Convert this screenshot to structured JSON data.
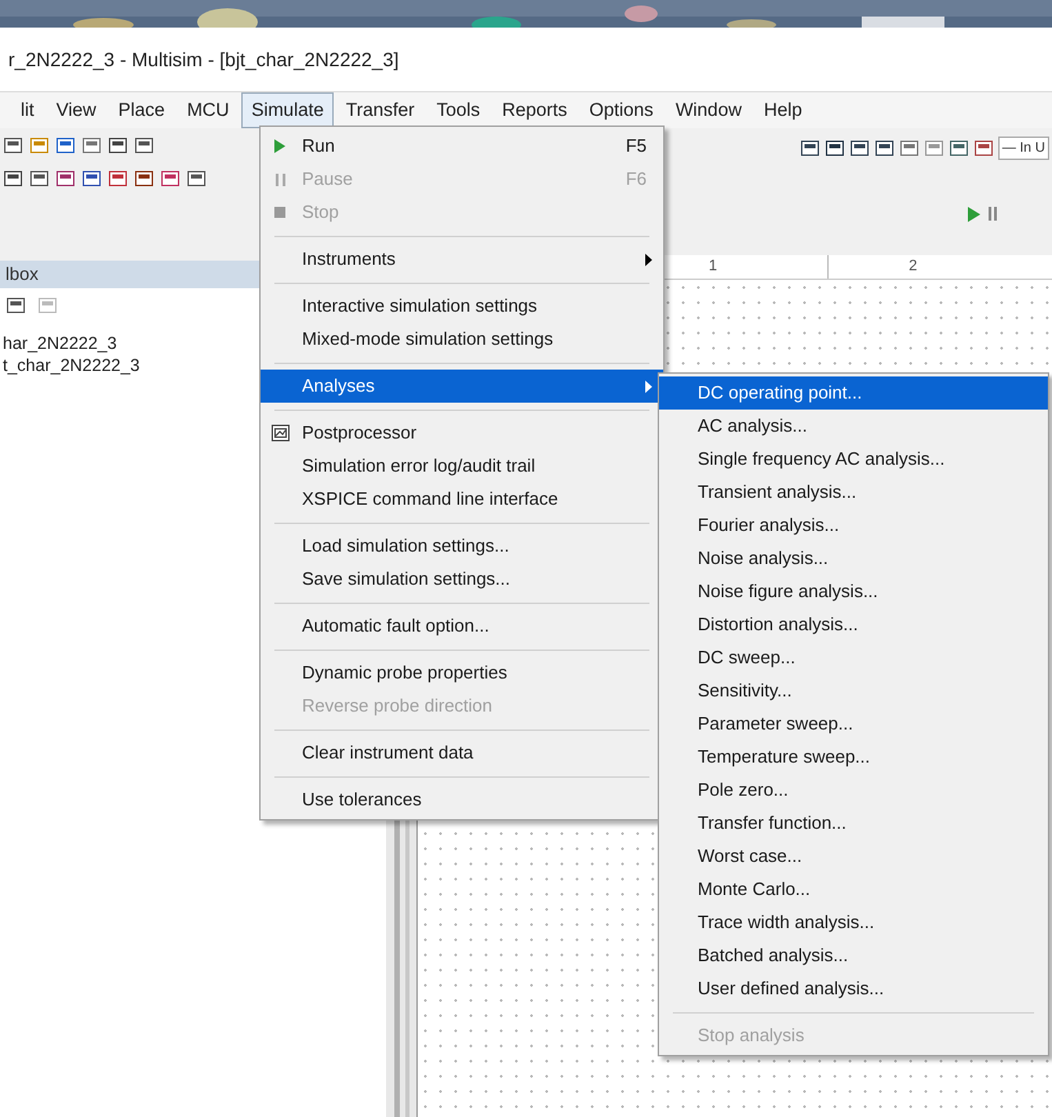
{
  "title": "r_2N2222_3 - Multisim - [bjt_char_2N2222_3]",
  "menubar": [
    {
      "label": "lit",
      "selected": false
    },
    {
      "label": "View",
      "selected": false
    },
    {
      "label": "Place",
      "selected": false
    },
    {
      "label": "MCU",
      "selected": false
    },
    {
      "label": "Simulate",
      "selected": true
    },
    {
      "label": "Transfer",
      "selected": false
    },
    {
      "label": "Tools",
      "selected": false
    },
    {
      "label": "Reports",
      "selected": false
    },
    {
      "label": "Options",
      "selected": false
    },
    {
      "label": "Window",
      "selected": false
    },
    {
      "label": "Help",
      "selected": false
    }
  ],
  "toolbar_combo": "— In U",
  "ruler": [
    "1",
    "2"
  ],
  "toolbox": {
    "title": "lbox",
    "items": [
      "har_2N2222_3",
      "t_char_2N2222_3"
    ]
  },
  "simulate_menu": [
    {
      "kind": "item",
      "label": "Run",
      "shortcut": "F5",
      "disabled": false,
      "selected": false
    },
    {
      "kind": "item",
      "label": "Pause",
      "shortcut": "F6",
      "disabled": true,
      "selected": false
    },
    {
      "kind": "item",
      "label": "Stop",
      "disabled": true,
      "selected": false
    },
    {
      "kind": "separator"
    },
    {
      "kind": "submenu",
      "label": "Instruments",
      "disabled": false,
      "selected": false
    },
    {
      "kind": "separator"
    },
    {
      "kind": "item",
      "label": "Interactive simulation settings",
      "disabled": false,
      "selected": false
    },
    {
      "kind": "item",
      "label": "Mixed-mode simulation settings",
      "disabled": false,
      "selected": false
    },
    {
      "kind": "separator"
    },
    {
      "kind": "submenu",
      "label": "Analyses",
      "disabled": false,
      "selected": true
    },
    {
      "kind": "separator"
    },
    {
      "kind": "item",
      "label": "Postprocessor",
      "disabled": false,
      "selected": false
    },
    {
      "kind": "item",
      "label": "Simulation error log/audit trail",
      "disabled": false,
      "selected": false
    },
    {
      "kind": "item",
      "label": "XSPICE command line interface",
      "disabled": false,
      "selected": false
    },
    {
      "kind": "separator"
    },
    {
      "kind": "item",
      "label": "Load simulation settings...",
      "disabled": false,
      "selected": false
    },
    {
      "kind": "item",
      "label": "Save simulation settings...",
      "disabled": false,
      "selected": false
    },
    {
      "kind": "separator"
    },
    {
      "kind": "item",
      "label": "Automatic fault option...",
      "disabled": false,
      "selected": false
    },
    {
      "kind": "separator"
    },
    {
      "kind": "item",
      "label": "Dynamic probe properties",
      "disabled": false,
      "selected": false
    },
    {
      "kind": "item",
      "label": "Reverse probe direction",
      "disabled": true,
      "selected": false
    },
    {
      "kind": "separator"
    },
    {
      "kind": "item",
      "label": "Clear instrument data",
      "disabled": false,
      "selected": false
    },
    {
      "kind": "separator"
    },
    {
      "kind": "item",
      "label": "Use tolerances",
      "disabled": false,
      "selected": false
    }
  ],
  "analyses_menu": [
    {
      "kind": "item",
      "label": "DC operating point...",
      "disabled": false,
      "selected": true
    },
    {
      "kind": "item",
      "label": "AC analysis...",
      "disabled": false,
      "selected": false
    },
    {
      "kind": "item",
      "label": "Single frequency AC analysis...",
      "disabled": false,
      "selected": false
    },
    {
      "kind": "item",
      "label": "Transient analysis...",
      "disabled": false,
      "selected": false
    },
    {
      "kind": "item",
      "label": "Fourier analysis...",
      "disabled": false,
      "selected": false
    },
    {
      "kind": "item",
      "label": "Noise analysis...",
      "disabled": false,
      "selected": false
    },
    {
      "kind": "item",
      "label": "Noise figure analysis...",
      "disabled": false,
      "selected": false
    },
    {
      "kind": "item",
      "label": "Distortion analysis...",
      "disabled": false,
      "selected": false
    },
    {
      "kind": "item",
      "label": "DC sweep...",
      "disabled": false,
      "selected": false
    },
    {
      "kind": "item",
      "label": "Sensitivity...",
      "disabled": false,
      "selected": false
    },
    {
      "kind": "item",
      "label": "Parameter sweep...",
      "disabled": false,
      "selected": false
    },
    {
      "kind": "item",
      "label": "Temperature sweep...",
      "disabled": false,
      "selected": false
    },
    {
      "kind": "item",
      "label": "Pole zero...",
      "disabled": false,
      "selected": false
    },
    {
      "kind": "item",
      "label": "Transfer function...",
      "disabled": false,
      "selected": false
    },
    {
      "kind": "item",
      "label": "Worst case...",
      "disabled": false,
      "selected": false
    },
    {
      "kind": "item",
      "label": "Monte Carlo...",
      "disabled": false,
      "selected": false
    },
    {
      "kind": "item",
      "label": "Trace width analysis...",
      "disabled": false,
      "selected": false
    },
    {
      "kind": "item",
      "label": "Batched analysis...",
      "disabled": false,
      "selected": false
    },
    {
      "kind": "item",
      "label": "User defined analysis...",
      "disabled": false,
      "selected": false
    },
    {
      "kind": "separator"
    },
    {
      "kind": "item",
      "label": "Stop analysis",
      "disabled": true,
      "selected": false
    }
  ]
}
